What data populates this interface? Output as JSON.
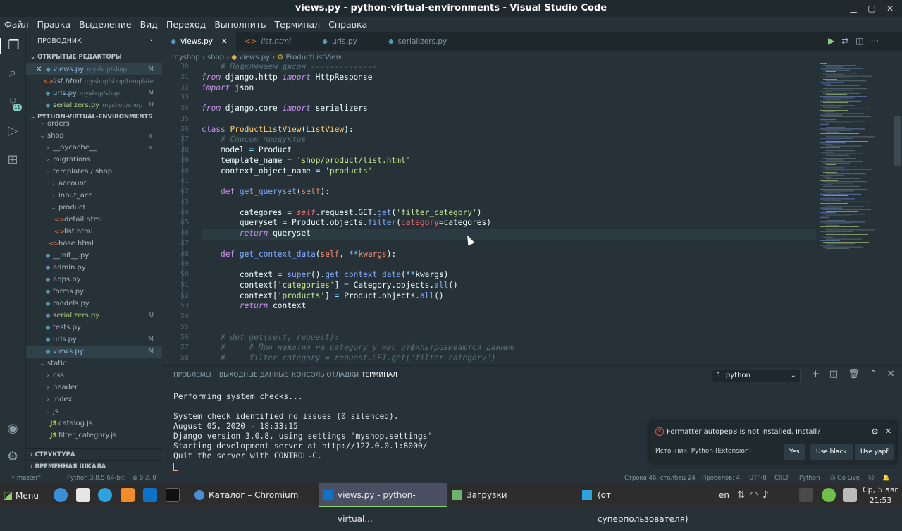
{
  "window": {
    "title": "views.py - python-virtual-environments - Visual Studio Code"
  },
  "menu": [
    "Файл",
    "Правка",
    "Выделение",
    "Вид",
    "Переход",
    "Выполнить",
    "Терминал",
    "Справка"
  ],
  "sidebar": {
    "header": "ПРОВОДНИК",
    "open_editors_title": "ОТКРЫТЫЕ РЕДАКТОРЫ",
    "open_editors": [
      {
        "name": "views.py",
        "path": "myshop/shop",
        "status": "M"
      },
      {
        "name": "list.html",
        "path": "myshop/shop/template...",
        "status": ""
      },
      {
        "name": "urls.py",
        "path": "myshop/shop",
        "status": "M"
      },
      {
        "name": "serializers.py",
        "path": "myshop/shop",
        "status": "U"
      }
    ],
    "project_title": "PYTHON-VIRTUAL-ENVIRONMENTS",
    "tree": [
      {
        "name": "orders",
        "depth": 1,
        "type": "folder"
      },
      {
        "name": "shop",
        "depth": 1,
        "type": "folder"
      },
      {
        "name": "__pycache__",
        "depth": 2,
        "type": "folder"
      },
      {
        "name": "migrations",
        "depth": 2,
        "type": "folder"
      },
      {
        "name": "templates / shop",
        "depth": 2,
        "type": "folder"
      },
      {
        "name": "account",
        "depth": 3,
        "type": "folder"
      },
      {
        "name": "input_acc",
        "depth": 3,
        "type": "folder"
      },
      {
        "name": "product",
        "depth": 3,
        "type": "folder"
      },
      {
        "name": "detail.html",
        "depth": 4,
        "type": "html"
      },
      {
        "name": "list.html",
        "depth": 4,
        "type": "html"
      },
      {
        "name": "base.html",
        "depth": 3,
        "type": "html"
      },
      {
        "name": "__init__.py",
        "depth": 2,
        "type": "py"
      },
      {
        "name": "admin.py",
        "depth": 2,
        "type": "py"
      },
      {
        "name": "apps.py",
        "depth": 2,
        "type": "py"
      },
      {
        "name": "forms.py",
        "depth": 2,
        "type": "py"
      },
      {
        "name": "models.py",
        "depth": 2,
        "type": "py"
      },
      {
        "name": "serializers.py",
        "depth": 2,
        "type": "py",
        "status": "U"
      },
      {
        "name": "tests.py",
        "depth": 2,
        "type": "py"
      },
      {
        "name": "urls.py",
        "depth": 2,
        "type": "py",
        "status": "M"
      },
      {
        "name": "views.py",
        "depth": 2,
        "type": "py",
        "status": "M"
      },
      {
        "name": "static",
        "depth": 1,
        "type": "folder"
      },
      {
        "name": "css",
        "depth": 2,
        "type": "folder"
      },
      {
        "name": "header",
        "depth": 2,
        "type": "folder"
      },
      {
        "name": "index",
        "depth": 2,
        "type": "folder"
      },
      {
        "name": "js",
        "depth": 2,
        "type": "folder"
      },
      {
        "name": "catalog.js",
        "depth": 3,
        "type": "js"
      },
      {
        "name": "filter_category.js",
        "depth": 3,
        "type": "js"
      }
    ],
    "structure_title": "СТРУКТУРА",
    "timeline_title": "ВРЕМЕННАЯ ШКАЛА"
  },
  "tabs": [
    {
      "label": "views.py",
      "active": true
    },
    {
      "label": "list.html",
      "active": false
    },
    {
      "label": "urls.py",
      "active": false
    },
    {
      "label": "serializers.py",
      "active": false
    }
  ],
  "breadcrumb": [
    "myshop",
    "shop",
    "views.py",
    "ProductListView"
  ],
  "code": [
    {
      "n": "30",
      "html": "<span class=\"cm\">    # Подключаем джсон --------------</span>"
    },
    {
      "n": "31",
      "html": "<span class=\"kw\">from</span> django.http <span class=\"kw\">import</span> HttpResponse"
    },
    {
      "n": "32",
      "html": "<span class=\"kw\">import</span> json"
    },
    {
      "n": "33",
      "html": ""
    },
    {
      "n": "34",
      "html": "<span class=\"kw\">from</span> django.core <span class=\"kw\">import</span> serializers"
    },
    {
      "n": "35",
      "html": ""
    },
    {
      "n": "36",
      "html": "<span class=\"kc\">class</span> <span class=\"cls\">ProductListView</span>(<span class=\"cls\">ListView</span>):"
    },
    {
      "n": "37",
      "html": "<span class=\"cm\">    # Список продуктов</span>"
    },
    {
      "n": "38",
      "html": "    model <span class=\"op\">=</span> Product"
    },
    {
      "n": "39",
      "html": "    template_name <span class=\"op\">=</span> <span class=\"st\">'shop/product/list.html'</span>"
    },
    {
      "n": "40",
      "html": "    context_object_name <span class=\"op\">=</span> <span class=\"st\">'products'</span>"
    },
    {
      "n": "41",
      "html": ""
    },
    {
      "n": "42",
      "html": "    <span class=\"kc\">def</span> <span class=\"fn\">get_queryset</span>(<span class=\"pm\">self</span>):"
    },
    {
      "n": "43",
      "html": ""
    },
    {
      "n": "44",
      "html": "        categores <span class=\"op\">=</span> <span class=\"sf\">self</span>.request.GET.<span class=\"fn\">get</span>(<span class=\"st\">'filter_category'</span>)"
    },
    {
      "n": "45",
      "html": "        queryset <span class=\"op\">=</span> Product.objects.<span class=\"fn\">filter</span>(<span class=\"sf\" style=\"font-style:normal\">category</span><span class=\"op\">=</span>categores)"
    },
    {
      "n": "46",
      "html": "        <span class=\"kw\">return</span> queryset"
    },
    {
      "n": "47",
      "html": ""
    },
    {
      "n": "48",
      "html": "    <span class=\"kc\">def</span> <span class=\"fn\">get_context_data</span>(<span class=\"pm\">self</span>, <span class=\"op\">**</span><span class=\"pm\">kwargs</span>):"
    },
    {
      "n": "49",
      "html": ""
    },
    {
      "n": "50",
      "html": "        context <span class=\"op\">=</span> <span class=\"fn\">super</span>().<span class=\"fn\">get_context_data</span>(<span class=\"op\">**</span>kwargs)"
    },
    {
      "n": "51",
      "html": "        context[<span class=\"st\">'categories'</span>] <span class=\"op\">=</span> Category.objects.<span class=\"fn\">all</span>()"
    },
    {
      "n": "52",
      "html": "        context[<span class=\"st\">'products'</span>] <span class=\"op\">=</span> Product.objects.<span class=\"fn\">all</span>()"
    },
    {
      "n": "53",
      "html": "        <span class=\"kw\">return</span> context"
    },
    {
      "n": "54",
      "html": ""
    },
    {
      "n": "55",
      "html": ""
    },
    {
      "n": "56",
      "html": "<span class=\"cm\">    # def get(self, request):</span>"
    },
    {
      "n": "57",
      "html": "<span class=\"cm\">    #     # При нажатии на category у нас отфильтровываются данные</span>"
    },
    {
      "n": "58",
      "html": "<span class=\"cm\">    #     filter_category = request.GET.get(\"filter_category\")</span>"
    }
  ],
  "panel": {
    "tabs": [
      "ПРОБЛЕМЫ",
      "ВЫХОДНЫЕ ДАННЫЕ",
      "КОНСОЛЬ ОТЛАДКИ",
      "ТЕРМИНАЛ"
    ],
    "active_tab": 3,
    "terminal_select": "1: python",
    "terminal": [
      "Performing system checks...",
      "",
      "System check identified no issues (0 silenced).",
      "August 05, 2020 - 18:33:15",
      "Django version 3.0.8, using settings 'myshop.settings'",
      "Starting development server at http://127.0.0.1:8000/",
      "Quit the server with CONTROL-C."
    ]
  },
  "notification": {
    "message": "Formatter autopep8 is not installed. Install?",
    "source": "Источник: Python (Extension)",
    "buttons": [
      "Yes",
      "Use black",
      "Use yapf"
    ]
  },
  "status": {
    "branch": "master*",
    "python": "Python 3.8.5 64-bit",
    "problems": "⊗ 0 ⚠ 0",
    "position": "Строка 46, столбец 24",
    "spaces": "Пробелов: 4",
    "encoding": "UTF-8",
    "eol": "CRLF",
    "language": "Python",
    "golive": "Go Live"
  },
  "taskbar": {
    "menu": "Menu",
    "tasks": [
      "Каталог – Chromium",
      "views.py - python-virtual...",
      "Загрузки",
      "(от суперпользователя)"
    ],
    "lang": "en",
    "date": "Ср, 5 авг",
    "time": "21:53"
  },
  "activity_badge": "11"
}
